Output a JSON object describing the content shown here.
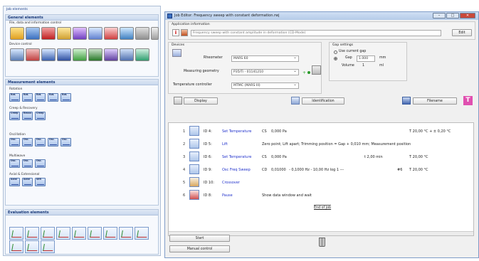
{
  "left_panel": {
    "title": "Job elements",
    "general": {
      "header": "General elements",
      "sub1": "File, data and information control",
      "sub2": "Device control"
    },
    "measurement": {
      "header": "Measurement elements",
      "rotation": "Rotation",
      "creep": "Creep & Recovery",
      "creep_btns": [
        "Creep",
        "Recov.",
        "Creep"
      ],
      "oscillation": "Oscillation",
      "multiwave": "Multiwave",
      "axial": "Axial & Extensional",
      "axial_btns": [
        "Axial",
        "Axial",
        "SER"
      ],
      "rot_btns": [
        "Rot.",
        "Rot.",
        "Rot.",
        "Rot.",
        "Rot."
      ],
      "osc_btns": [
        "Osc.",
        "Osc.",
        "Osc.",
        "Osc.",
        "Osc."
      ],
      "multi_btns": [
        "Osc.",
        "Osc.",
        "Osc."
      ]
    },
    "evaluation": {
      "header": "Evaluation elements"
    }
  },
  "editor": {
    "title": "Job Editor: Frequency sweep with constant deformation.rwj",
    "app_info": {
      "header": "Application information",
      "description": "Frequency sweep with constant amplitude in deformation (CD-Mode)",
      "edit_label": "Edit"
    },
    "devices": {
      "header": "Devices",
      "rheometer_label": "Rheometer",
      "rheometer_value": "MARS 60",
      "geometry_label": "Measuring geometry",
      "geometry_value": "P35/Ti - 01141210",
      "temp_label": "Temperature controller",
      "temp_value": "MTMC (MARS III)"
    },
    "gap": {
      "header": "Gap settings",
      "use_current": "Use current gap",
      "gap_label": "Gap",
      "gap_value": "1.000",
      "gap_unit": "mm",
      "volume_label": "Volume",
      "volume_value": "1",
      "volume_unit": "ml"
    },
    "toolbar": {
      "display": "Display",
      "identification": "Identification",
      "filename": "Filename"
    },
    "jobs": [
      {
        "num": "1",
        "id": "ID 4:",
        "name": "Set Temperature",
        "p1": "CS",
        "p2": "0,000 Pa",
        "p3": "",
        "p4": "T 20,00 °C + ± 0,20 °C"
      },
      {
        "num": "2",
        "id": "ID 5:",
        "name": "Lift",
        "p1": "Zero point; Lift apart; Trimming position = Gap  + 0,010 mm; Measurement position",
        "p2": "",
        "p3": "",
        "p4": ""
      },
      {
        "num": "3",
        "id": "ID 6:",
        "name": "Set Temperature",
        "p1": "CS",
        "p2": "0,000 Pa",
        "p3": "t 2,00 min",
        "p4": "T 20,00 °C"
      },
      {
        "num": "4",
        "id": "ID 9:",
        "name": "Osc Freq Sweep",
        "p1": "CD",
        "p2": "0,01000",
        "p3": "- 0,1000 Hz - 10,00 Hz log  1 ---",
        "p3b": "#6",
        "p4": "T 20,00 °C"
      },
      {
        "num": "5",
        "id": "ID 10:",
        "name": "Crossover",
        "p1": "",
        "p2": "",
        "p3": "",
        "p4": ""
      },
      {
        "num": "6",
        "id": "ID 8:",
        "name": "Pause",
        "p1": "Show data window and wait",
        "p2": "",
        "p3": "",
        "p4": ""
      }
    ],
    "end_of_job": "End of job",
    "start_label": "Start",
    "manual_label": "Manual control"
  },
  "colors": {
    "accent": "#2233cc",
    "red": "#d40000",
    "pink": "#d04090"
  }
}
